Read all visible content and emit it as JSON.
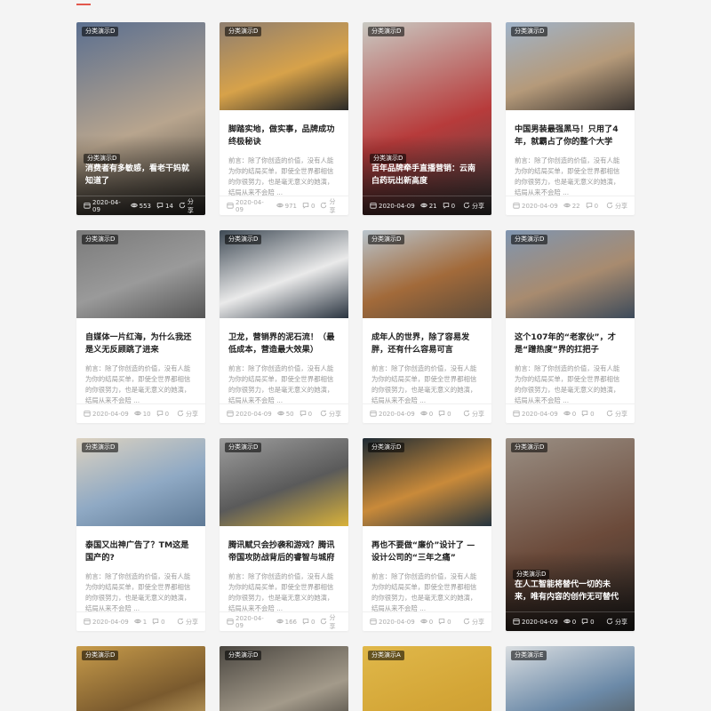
{
  "excerpt_default": "前言：除了你创造的价值，没有人能为你的结局买单，即使全世界都相信的你很努力，也是毫无意义的她演，结局从来不会陪 ...",
  "share_label": "分享",
  "cards": [
    {
      "id": "c1",
      "category": "分类演示D",
      "title": "消费者有多敏感，看老干妈就知道了",
      "date": "2020-04-09",
      "views": "553",
      "comments": "14",
      "layout": "overlay",
      "colors": [
        "#5b6f8f",
        "#b8a58e",
        "#3d3a35"
      ]
    },
    {
      "id": "c2",
      "category": "分类演示D",
      "title": "脚踏实地，做实事，品牌成功终极秘诀",
      "date": "2020-04-09",
      "views": "971",
      "comments": "0",
      "layout": "image",
      "colors": [
        "#8e7e70",
        "#d7a24a",
        "#2b2a28"
      ]
    },
    {
      "id": "c3",
      "category": "分类演示D",
      "title": "百年品牌牵手直播营销：云南白药玩出新高度",
      "date": "2020-04-09",
      "views": "21",
      "comments": "0",
      "layout": "overlay",
      "colors": [
        "#c9c9c2",
        "#b73b3b",
        "#4a4a4a"
      ]
    },
    {
      "id": "c4",
      "category": "分类演示D",
      "title": "中国男装最强黑马！只用了4年，就霸占了你的整个大学",
      "date": "2020-04-09",
      "views": "22",
      "comments": "0",
      "layout": "image",
      "colors": [
        "#9fb3c9",
        "#b59a7a",
        "#3a3430"
      ]
    },
    {
      "id": "c5",
      "category": "分类演示D",
      "title": "自媒体一片红海，为什么我还是义无反顾跳了进来",
      "date": "2020-04-09",
      "views": "10",
      "comments": "0",
      "layout": "image",
      "colors": [
        "#7a7a7a",
        "#9a9a9a",
        "#555555"
      ]
    },
    {
      "id": "c6",
      "category": "分类演示D",
      "title": "卫龙，营销界的泥石流！（最低成本，营造最大效果）",
      "date": "2020-04-09",
      "views": "50",
      "comments": "0",
      "layout": "image",
      "colors": [
        "#3f4a55",
        "#eaeaea",
        "#2a3440"
      ]
    },
    {
      "id": "c7",
      "category": "分类演示D",
      "title": "成年人的世界，除了容易发胖，还有什么容易可言",
      "date": "2020-04-09",
      "views": "0",
      "comments": "0",
      "layout": "image",
      "colors": [
        "#b9c4cc",
        "#a26a3a",
        "#5b4b3b"
      ]
    },
    {
      "id": "c8",
      "category": "分类演示D",
      "title": "这个107年的“老家伙”，才是“蹭热度”界的扛把子",
      "date": "2020-04-09",
      "views": "0",
      "comments": "0",
      "layout": "image",
      "colors": [
        "#7f95b0",
        "#a88b6f",
        "#3c4a5a"
      ]
    },
    {
      "id": "c9",
      "category": "分类演示D",
      "title": "泰国又出神广告了？TM这是国产的?",
      "date": "2020-04-09",
      "views": "1",
      "comments": "0",
      "layout": "image",
      "colors": [
        "#dcd2c0",
        "#8fa9c4",
        "#5f7a96"
      ]
    },
    {
      "id": "c10",
      "category": "分类演示D",
      "title": "腾讯赋只会抄袭和游戏？腾讯帝国攻防战背后的睿智与城府",
      "date": "2020-04-09",
      "views": "166",
      "comments": "0",
      "layout": "image",
      "colors": [
        "#9e9e9e",
        "#5a5a5a",
        "#d9b23a"
      ]
    },
    {
      "id": "c11",
      "category": "分类演示D",
      "title": "再也不要做“廉价”设计了 — 设计公司的“三年之痛”",
      "date": "2020-04-09",
      "views": "0",
      "comments": "0",
      "layout": "image",
      "colors": [
        "#1e2a33",
        "#c98a3a",
        "#26343e"
      ]
    },
    {
      "id": "c12",
      "category": "分类演示D",
      "title": "在人工智能将替代一切的未来，唯有内容的创作无可替代",
      "date": "2020-04-09",
      "views": "0",
      "comments": "0",
      "layout": "overlay",
      "colors": [
        "#9a8f84",
        "#6b4a3a",
        "#2f2c2a"
      ]
    },
    {
      "id": "c13",
      "category": "分类演示D",
      "layout": "short",
      "colors": [
        "#c79b4a",
        "#7a5a2e",
        "#e2c27a"
      ]
    },
    {
      "id": "c14",
      "category": "分类演示D",
      "layout": "short",
      "colors": [
        "#4a4640",
        "#a39a8a",
        "#2e2b27"
      ]
    },
    {
      "id": "c15",
      "category": "分类演示A",
      "layout": "short",
      "colors": [
        "#e0b84a",
        "#d4a637",
        "#c99a2e"
      ]
    },
    {
      "id": "c16",
      "category": "分类演示E",
      "layout": "short",
      "colors": [
        "#d9dde0",
        "#6c8aa8",
        "#4a4a44"
      ]
    }
  ]
}
